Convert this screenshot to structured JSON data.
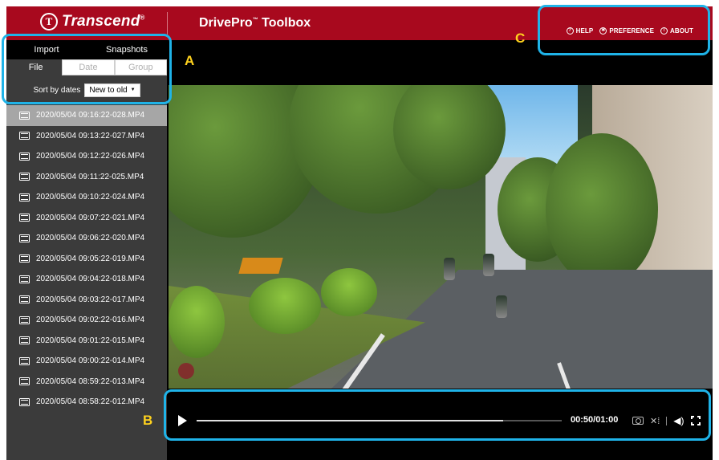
{
  "header": {
    "brand": "Transcend",
    "brand_mark": "T",
    "app_title": "DrivePro",
    "app_title_tm": "™",
    "app_title_suffix": " Toolbox",
    "links": [
      {
        "label": "HELP",
        "icon": "help-icon"
      },
      {
        "label": "PREFERENCE",
        "icon": "gear-icon"
      },
      {
        "label": "ABOUT",
        "icon": "info-icon"
      }
    ]
  },
  "sidebar": {
    "top_tabs": [
      "Import",
      "Snapshots"
    ],
    "sub_tabs": [
      "File",
      "Date",
      "Group"
    ],
    "active_sub_tab": "File",
    "sort_label": "Sort by dates",
    "sort_value": "New to old",
    "files": [
      "2020/05/04 09:16:22-028.MP4",
      "2020/05/04 09:13:22-027.MP4",
      "2020/05/04 09:12:22-026.MP4",
      "2020/05/04 09:11:22-025.MP4",
      "2020/05/04 09:10:22-024.MP4",
      "2020/05/04 09:07:22-021.MP4",
      "2020/05/04 09:06:22-020.MP4",
      "2020/05/04 09:05:22-019.MP4",
      "2020/05/04 09:04:22-018.MP4",
      "2020/05/04 09:03:22-017.MP4",
      "2020/05/04 09:02:22-016.MP4",
      "2020/05/04 09:01:22-015.MP4",
      "2020/05/04 09:00:22-014.MP4",
      "2020/05/04 08:59:22-013.MP4",
      "2020/05/04 08:58:22-012.MP4"
    ],
    "selected_index": 0
  },
  "player": {
    "time": "00:50/01:00",
    "progress": 0.84
  },
  "annotations": [
    "A",
    "B",
    "C"
  ],
  "colors": {
    "brand_red": "#a8091e",
    "annotation_blue": "#1fb3e8",
    "annotation_label": "#ffd21e"
  }
}
